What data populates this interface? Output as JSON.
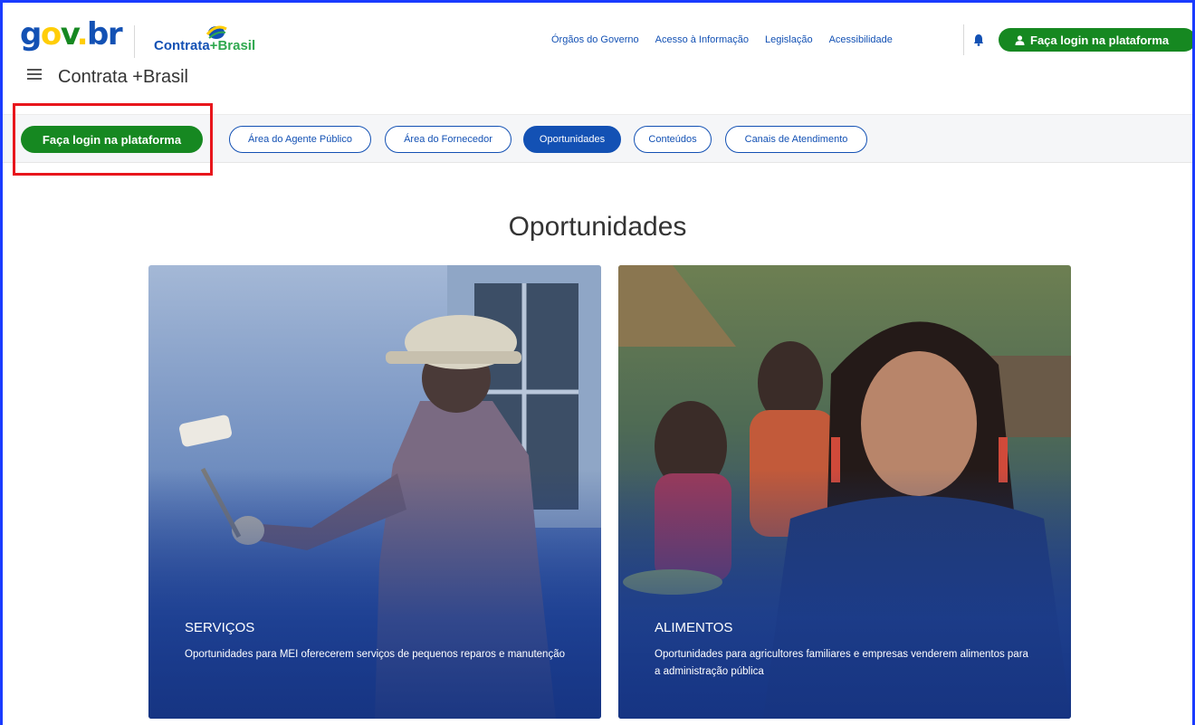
{
  "header": {
    "gov_logo": "gov.br",
    "contrata_logo": "Contrata+Brasil",
    "site_title": "Contrata +Brasil",
    "top_links": [
      "Órgãos do Governo",
      "Acesso à Informação",
      "Legislação",
      "Acessibilidade"
    ],
    "login_label": "Faça login na plataforma"
  },
  "nav": {
    "login_label": "Faça login na plataforma",
    "items": [
      "Área do Agente Público",
      "Área do Fornecedor",
      "Oportunidades",
      "Conteúdos",
      "Canais de Atendimento"
    ],
    "active": "Oportunidades"
  },
  "main": {
    "title": "Oportunidades",
    "cards": [
      {
        "title": "SERVIÇOS",
        "description": "Oportunidades para MEI oferecerem serviços de pequenos reparos e manutenção"
      },
      {
        "title": "ALIMENTOS",
        "description": "Oportunidades para agricultores familiares e empresas venderem alimentos para a administração pública"
      }
    ]
  },
  "colors": {
    "gov_blue": "#1351b4",
    "gov_green": "#168821",
    "highlight_red": "#e8161c",
    "frame_blue": "#1a3bff"
  }
}
